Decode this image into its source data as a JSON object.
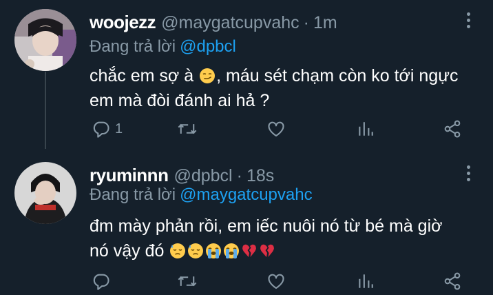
{
  "tweets": [
    {
      "display_name": "woojezz",
      "handle": "@maygatcupvahc",
      "dot": "·",
      "time": "1m",
      "reply_prefix": "Đang trả lời",
      "reply_to": "@dpbcl",
      "text_line1_a": "chắc em sợ à ",
      "text_line1_b": ", máu sét chạm còn ko tới ngực",
      "text_line2": "em mà đòi đánh ai hả ?",
      "reply_count": "1",
      "avatar_icon": "avatar-photo-icon",
      "emojis": [
        "smirking-face-emoji"
      ]
    },
    {
      "display_name": "ryuminnn",
      "handle": "@dpbcl",
      "dot": "·",
      "time": "18s",
      "reply_prefix": "Đang trả lời",
      "reply_to": "@maygatcupvahc",
      "text_line1": "đm mày phản rồi, em iếc nuôi nó từ bé mà giờ",
      "text_line2": "nó vậy đó ",
      "reply_count": "",
      "avatar_icon": "avatar-photo-icon",
      "emojis": [
        "downcast-sweat-emoji",
        "downcast-sweat-emoji",
        "loudly-crying-emoji",
        "loudly-crying-emoji",
        "broken-heart-emoji",
        "broken-heart-emoji"
      ]
    }
  ],
  "colors": {
    "background": "#15202b",
    "secondary_text": "#8899a6",
    "mention": "#1da1f2",
    "thread_line": "#38444d"
  }
}
